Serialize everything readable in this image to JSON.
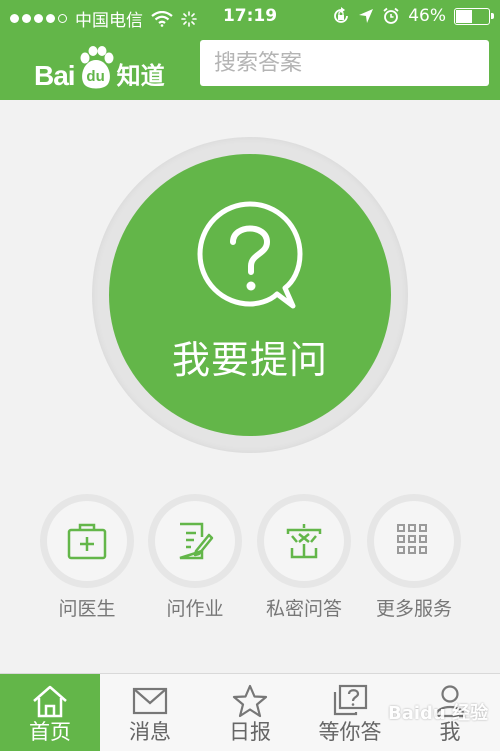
{
  "status_bar": {
    "signal_bars": 4,
    "carrier": "中国电信",
    "time": "17:19",
    "battery_text": "46%",
    "battery_level": 0.46
  },
  "header": {
    "logo_latin": "Bai",
    "logo_du": "du",
    "logo_cn": "知道",
    "search_placeholder": "搜索答案"
  },
  "ask_button": {
    "label": "我要提问"
  },
  "services": [
    {
      "label": "问医生",
      "icon": "medical-kit-icon"
    },
    {
      "label": "问作业",
      "icon": "homework-icon"
    },
    {
      "label": "私密问答",
      "icon": "private-icon"
    },
    {
      "label": "更多服务",
      "icon": "grid-icon"
    }
  ],
  "tabs": [
    {
      "label": "首页",
      "icon": "home-icon",
      "active": true
    },
    {
      "label": "消息",
      "icon": "message-icon",
      "active": false
    },
    {
      "label": "日报",
      "icon": "star-icon",
      "active": false
    },
    {
      "label": "等你答",
      "icon": "question-icon",
      "active": false
    },
    {
      "label": "我",
      "icon": "user-icon",
      "active": false
    }
  ],
  "watermark": "Baidu 经验",
  "colors": {
    "brand_green": "#63b649",
    "background": "#f2f2f2",
    "icon_green": "#63b649",
    "tab_text": "#666666"
  }
}
